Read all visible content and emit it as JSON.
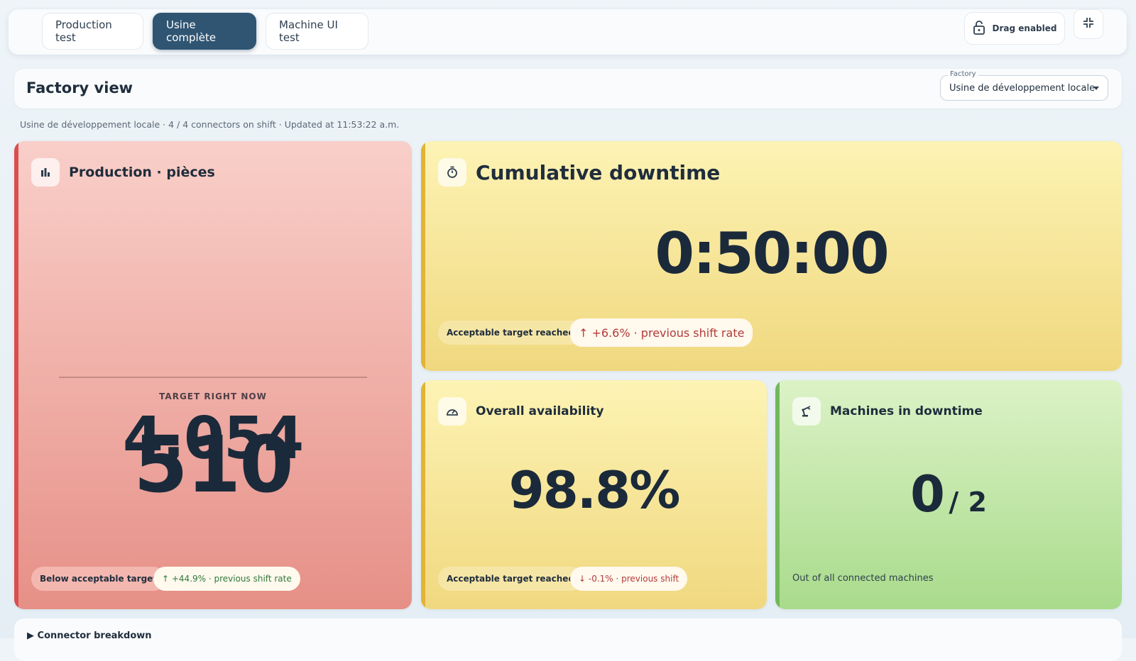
{
  "tabs": [
    {
      "label": "Production test",
      "active": false
    },
    {
      "label": "Usine complète",
      "active": true
    },
    {
      "label": "Machine UI test",
      "active": false
    }
  ],
  "toolbar": {
    "drag_label": "Drag enabled",
    "drag_icon": "lock-open-icon",
    "collapse_icon": "collapse-icon"
  },
  "header": {
    "title": "Factory view",
    "factory_label": "Factory",
    "factory_value": "Usine de développement locale"
  },
  "status_line": "Usine de développement locale · 4 / 4 connectors on shift · Updated at 11:53:22 a.m.",
  "colors": {
    "active_tab": "#2f5572",
    "red_accent": "#d94f4f",
    "yellow_accent": "#e2b434",
    "green_accent": "#72b85a",
    "trend_up_green": "#2f7a3a",
    "trend_red": "#b33a3a"
  },
  "cards": {
    "production": {
      "icon": "bar-chart-icon",
      "title": "Production · pièces",
      "value": "510",
      "target_label": "TARGET RIGHT NOW",
      "target_value": "4,054",
      "status": "Below acceptable target",
      "trend": "↑ +44.9% · previous shift rate"
    },
    "downtime": {
      "icon": "stopwatch-icon",
      "title": "Cumulative downtime",
      "value": "0:50:00",
      "status": "Acceptable target reached",
      "trend": "↑ +6.6% · previous shift rate"
    },
    "availability": {
      "icon": "gauge-icon",
      "title": "Overall availability",
      "value": "98.8%",
      "status": "Acceptable target reached",
      "trend": "↓ -0.1% · previous shift"
    },
    "machines": {
      "icon": "robot-arm-icon",
      "title": "Machines in downtime",
      "value": "0",
      "total": "/ 2",
      "caption": "Out of all connected machines"
    }
  },
  "breakdown": {
    "label": "▶ Connector breakdown"
  }
}
